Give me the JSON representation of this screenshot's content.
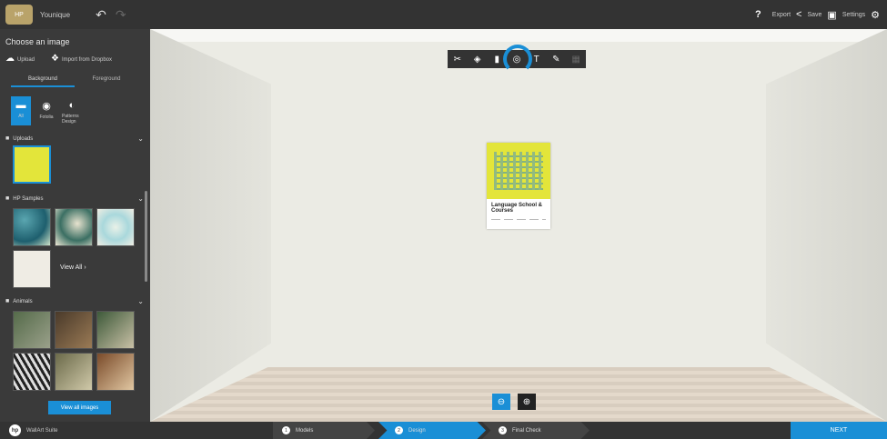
{
  "topbar": {
    "project_name": "Younique",
    "help": "?",
    "export_label": "Export",
    "save_label": "Save",
    "settings_label": "Settings",
    "logo_text": "HP"
  },
  "sidebar": {
    "title": "Choose an image",
    "upload_label": "Upload",
    "dropbox_label": "Import from Dropbox",
    "tabs": [
      "Background",
      "Foreground"
    ],
    "filters": [
      "All",
      "Fotolia",
      "Patterns Design"
    ],
    "sections": [
      "Uploads",
      "HP Samples",
      "Animals"
    ],
    "view_all": "View All",
    "view_all_images": "View all images"
  },
  "toolbar": {
    "tools": [
      "crop-icon",
      "fill-icon",
      "frame-icon",
      "zoom-focus-icon",
      "text-icon",
      "edit-icon",
      "grid-icon"
    ]
  },
  "poster": {
    "title": "Language School & Courses"
  },
  "bottombar": {
    "suite_name": "WallArt Suite",
    "steps": [
      {
        "num": "1",
        "label": "Models"
      },
      {
        "num": "2",
        "label": "Design"
      },
      {
        "num": "3",
        "label": "Final Check"
      }
    ],
    "next_label": "NEXT"
  },
  "colors": {
    "accent": "#1a8fd6",
    "panel": "#3a3a3a",
    "topbar": "#333333",
    "wall": "#ebebe4"
  }
}
